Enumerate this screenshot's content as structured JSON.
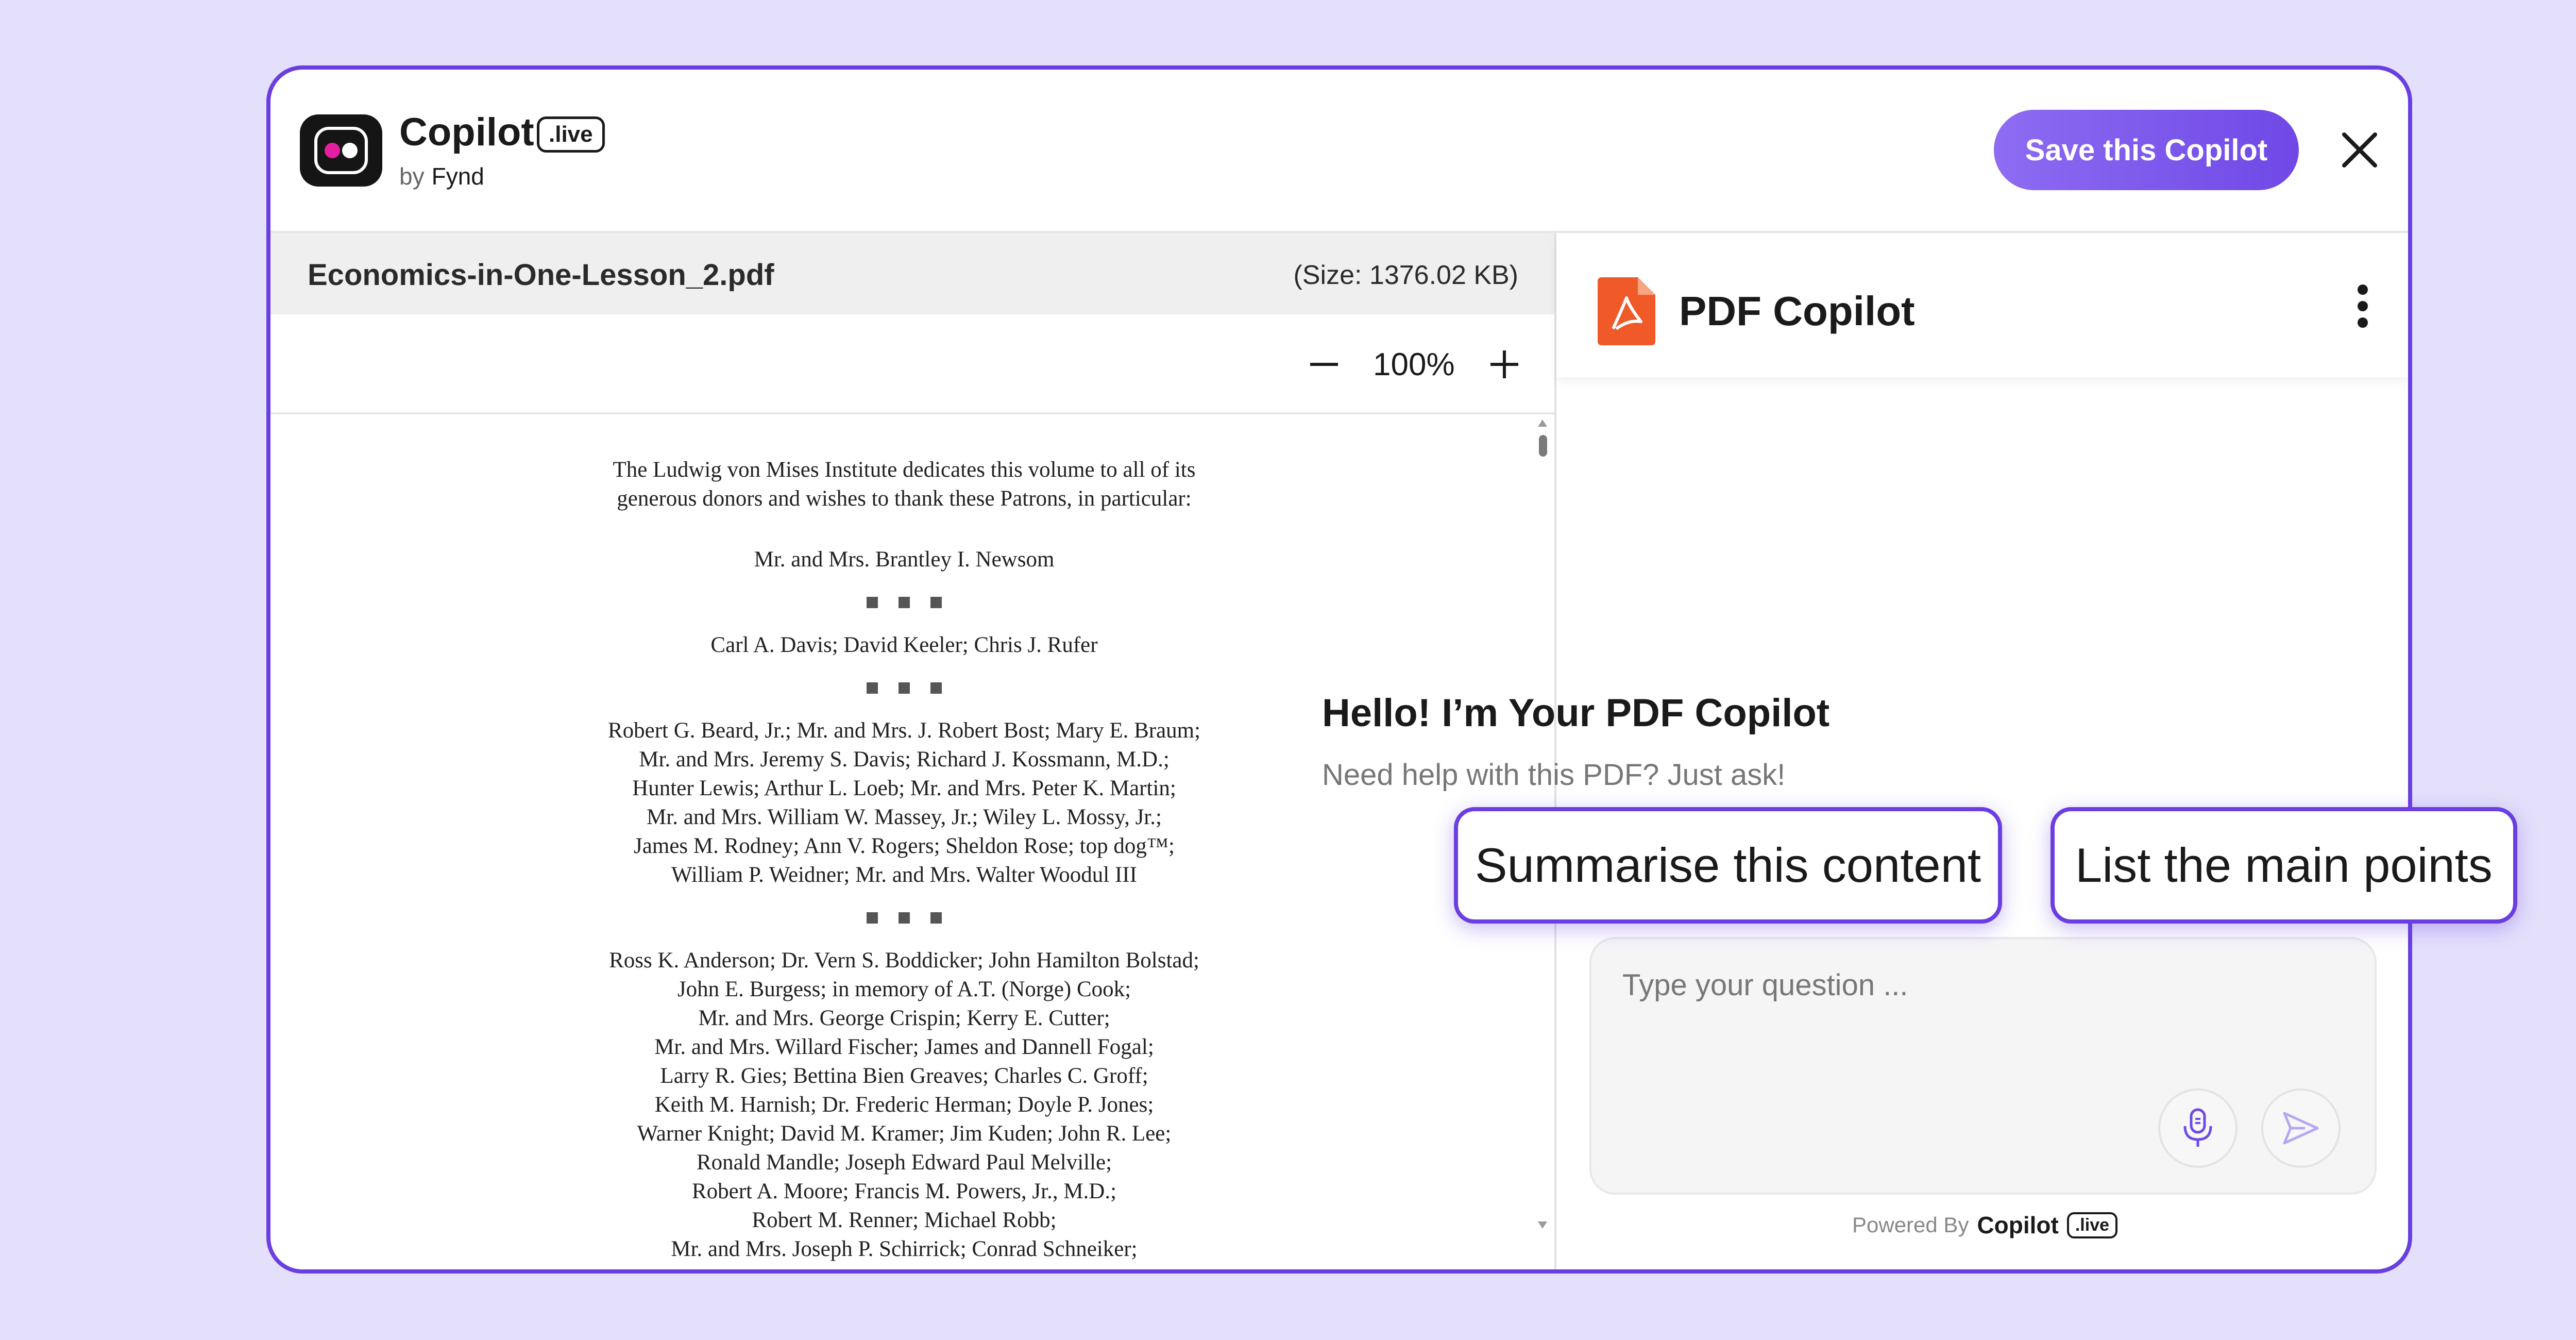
{
  "header": {
    "brand_name": "Copilot",
    "brand_badge": ".live",
    "by_label": "by",
    "by_company": "Fynd",
    "save_button": "Save this Copilot",
    "close_icon": "close-icon"
  },
  "document": {
    "file_name": "Economics-in-One-Lesson_2.pdf",
    "file_size": "(Size: 1376.02 KB)",
    "zoom_level": "100%",
    "lines": [
      "The Ludwig von Mises Institute dedicates this volume to all of its",
      "generous donors and wishes to thank these Patrons, in particular:",
      "Mr. and Mrs. Brantley I. Newsom",
      "Carl A. Davis; David Keeler; Chris J. Rufer",
      "Robert G. Beard, Jr.; Mr. and Mrs. J. Robert Bost; Mary E. Braum;",
      "Mr. and Mrs. Jeremy S. Davis; Richard J. Kossmann, M.D.;",
      "Hunter Lewis; Arthur L. Loeb; Mr. and Mrs. Peter K. Martin;",
      "Mr. and Mrs. William W. Massey, Jr.; Wiley L. Mossy, Jr.;",
      "James M. Rodney; Ann V. Rogers; Sheldon Rose; top dog™;",
      "William P. Weidner; Mr. and Mrs. Walter Woodul III",
      "Ross K. Anderson; Dr. Vern S. Boddicker; John Hamilton Bolstad;",
      "John E. Burgess; in memory of A.T. (Norge) Cook;",
      "Mr. and Mrs. George Crispin; Kerry E. Cutter;",
      "Mr. and Mrs. Willard Fischer; James and Dannell Fogal;",
      "Larry R. Gies; Bettina Bien Greaves; Charles C. Groff;",
      "Keith M. Harnish; Dr. Frederic Herman; Doyle P. Jones;",
      "Warner Knight; David M. Kramer; Jim Kuden; John R. Lee;",
      "Ronald Mandle; Joseph Edward Paul Melville;",
      "Robert A. Moore; Francis M. Powers, Jr., M.D.;",
      "Robert M. Renner; Michael Robb;",
      "Mr. and Mrs. Joseph P. Schirrick; Conrad Schneiker;"
    ]
  },
  "chat": {
    "title": "PDF Copilot",
    "greeting_title": "Hello! I’m Your PDF Copilot",
    "greeting_sub": "Need help with this PDF? Just ask!",
    "suggestions": [
      "Summarise this content",
      "List the main points"
    ],
    "input_placeholder": "Type your question ...",
    "powered_label": "Powered By",
    "powered_name": "Copilot",
    "powered_badge": ".live"
  },
  "colors": {
    "accent": "#6a3ee0",
    "save_gradient_start": "#8e6cf2",
    "save_gradient_end": "#6f48e6",
    "pdf_icon": "#f05a28",
    "background": "#e4e0fb"
  }
}
